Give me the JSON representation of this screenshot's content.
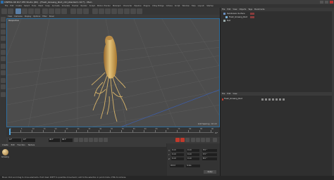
{
  "window": {
    "title": "CINEMA 4D R17.055 Studio (RC) - [Fresh_Ginseng_Root_c4d_standard.c4d *] - Main",
    "accent": "#2f6f9f"
  },
  "menubar": {
    "items": [
      "File",
      "Edit",
      "Create",
      "Select",
      "Tools",
      "Mesh",
      "Snap",
      "Animate",
      "Simulate",
      "Tracker",
      "Render",
      "Sculpt",
      "Motion Tracker",
      "MoGraph",
      "Character",
      "Pipeline",
      "Plugins",
      "V-Ray Bridge",
      "Octane",
      "Script",
      "Window",
      "Help",
      "Layout:",
      "Startup"
    ]
  },
  "viewport": {
    "menu": [
      "View",
      "Cameras",
      "Display",
      "Options",
      "Filter",
      "Panel"
    ],
    "label": "Perspective",
    "status": "Grid Spacing : 10 cm"
  },
  "timeline": {
    "ticks": [
      "0",
      "5",
      "10",
      "15",
      "20",
      "25",
      "30",
      "35",
      "40",
      "45",
      "50",
      "55",
      "60",
      "65",
      "70",
      "75",
      "80",
      "85",
      "90"
    ],
    "end_label": "0 F"
  },
  "transport": {
    "start": "0 F",
    "current": "0 F",
    "end": "90 F",
    "max": "90 F"
  },
  "bottom_panel": {
    "tabs": [
      "Create",
      "Edit",
      "Function",
      "Texture"
    ],
    "material_name": "Ginseng"
  },
  "coordinates": {
    "rows": [
      {
        "axis": "X",
        "pos": "0 cm",
        "size": "0 cm",
        "rot": "H 0 °"
      },
      {
        "axis": "Y",
        "pos": "0 cm",
        "size": "0 cm",
        "rot": "P 0 °"
      },
      {
        "axis": "Z",
        "pos": "0 cm",
        "size": "0 cm",
        "rot": "B 0 °"
      }
    ],
    "mode_world": "World",
    "mode_scale": "Scale",
    "apply": "Apply"
  },
  "object_manager": {
    "tabs": [
      "File",
      "Edit",
      "View",
      "Objects",
      "Tags",
      "Bookmarks"
    ],
    "objects": [
      {
        "name": "Subdivision Surface"
      },
      {
        "name": "Fresh_Ginseng_Root"
      },
      {
        "name": "Null"
      }
    ]
  },
  "layer_manager": {
    "tabs": [
      "File",
      "Edit",
      "View"
    ],
    "layer_name": "Fresh_Ginseng_Root"
  },
  "statusbar": {
    "text": "Move: Click and drag to move elements. Hold down SHIFT to quantize movement / add to the selection in point mode, CTRL to remove."
  },
  "colors": {
    "root_light": "#e2c27a",
    "root_dark": "#9a6a2c"
  }
}
